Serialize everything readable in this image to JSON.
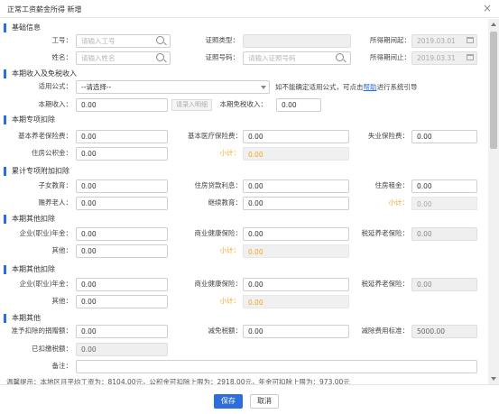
{
  "window": {
    "title": "正常工资薪金所得 新增",
    "close_icon": "×"
  },
  "sections": {
    "basic": "基础信息",
    "income": "本期收入及免税收入",
    "special": "本期专项扣除",
    "cumulative": "累计专项附加扣除",
    "other1": "本期其他扣除",
    "other2": "本期其他扣除",
    "misc": "本期其他"
  },
  "basic": {
    "emp_no_label": "工号：",
    "emp_no_placeholder": "请输入工号",
    "cert_type_label": "证照类型：",
    "cert_type_value": "",
    "period_start_label": "所得期间起：",
    "period_start_value": "2019.03.01",
    "name_label": "姓名：",
    "name_placeholder": "请输入姓名",
    "cert_no_label": "证照号码：",
    "cert_no_placeholder": "请输入证照号码",
    "period_end_label": "所得期间止：",
    "period_end_value": "2019.03.31"
  },
  "income": {
    "formula_label": "适用公式：",
    "formula_value": "--请选择--",
    "formula_hint_pre": "如不能确定适用公式，可点击",
    "formula_hint_link": "帮助",
    "formula_hint_post": "进行系统引导",
    "current_income_label": "本期收入：",
    "current_income_value": "0.00",
    "detail_button": "请录入明细",
    "exempt_income_label": "本期免税收入：",
    "exempt_income_value": "0.00"
  },
  "special": {
    "pension_label": "基本养老保险费：",
    "pension_value": "0.00",
    "medical_label": "基本医疗保险费：",
    "medical_value": "0.00",
    "unemployment_label": "失业保险费：",
    "unemployment_value": "0.00",
    "housing_fund_label": "住房公积金：",
    "housing_fund_value": "0.00",
    "subtotal_label": "小计：",
    "subtotal_value": "0.00"
  },
  "cumulative": {
    "children_edu_label": "子女教育：",
    "children_edu_value": "0.00",
    "housing_loan_label": "住房贷款利息：",
    "housing_loan_value": "0.00",
    "housing_rent_label": "住房租金：",
    "housing_rent_value": "0.00",
    "elderly_label": "赡养老人：",
    "elderly_value": "0.00",
    "continuing_edu_label": "继续教育：",
    "continuing_edu_value": "0.00",
    "subtotal_label": "小计：",
    "subtotal_value": "0.00"
  },
  "other1": {
    "annuity_label": "企业(职业)年金：",
    "annuity_value": "0.00",
    "health_label": "商业健康保险：",
    "health_value": "0.00",
    "deferred_pension_label": "税延养老保险：",
    "deferred_pension_value": "0.00",
    "other_label": "其他：",
    "other_value": "0.00",
    "subtotal_label": "小计：",
    "subtotal_value": "0.00"
  },
  "other2": {
    "annuity_label": "企业(职业)年金：",
    "annuity_value": "0.00",
    "health_label": "商业健康保险：",
    "health_value": "0.00",
    "deferred_pension_label": "税延养老保险：",
    "deferred_pension_value": "0.00",
    "other_label": "其他：",
    "other_value": "0.00",
    "subtotal_label": "小计：",
    "subtotal_value": "0.00"
  },
  "misc": {
    "donation_label": "准予扣除的捐赠额：",
    "donation_value": "0.00",
    "tax_relief_label": "减免税额：",
    "tax_relief_value": "0.00",
    "deduction_std_label": "减除费用标准：",
    "deduction_std_value": "5000.00",
    "withheld_label": "已扣缴税额：",
    "withheld_value": "0.00",
    "remark_label": "备注：",
    "remark_value": ""
  },
  "tip": "温馨提示：本地区月平均工资为：8104.00元，公积金可扣除上限为：2918.00元，年金可扣除上限为：973.00元",
  "footer": {
    "save": "保存",
    "cancel": "取消"
  }
}
